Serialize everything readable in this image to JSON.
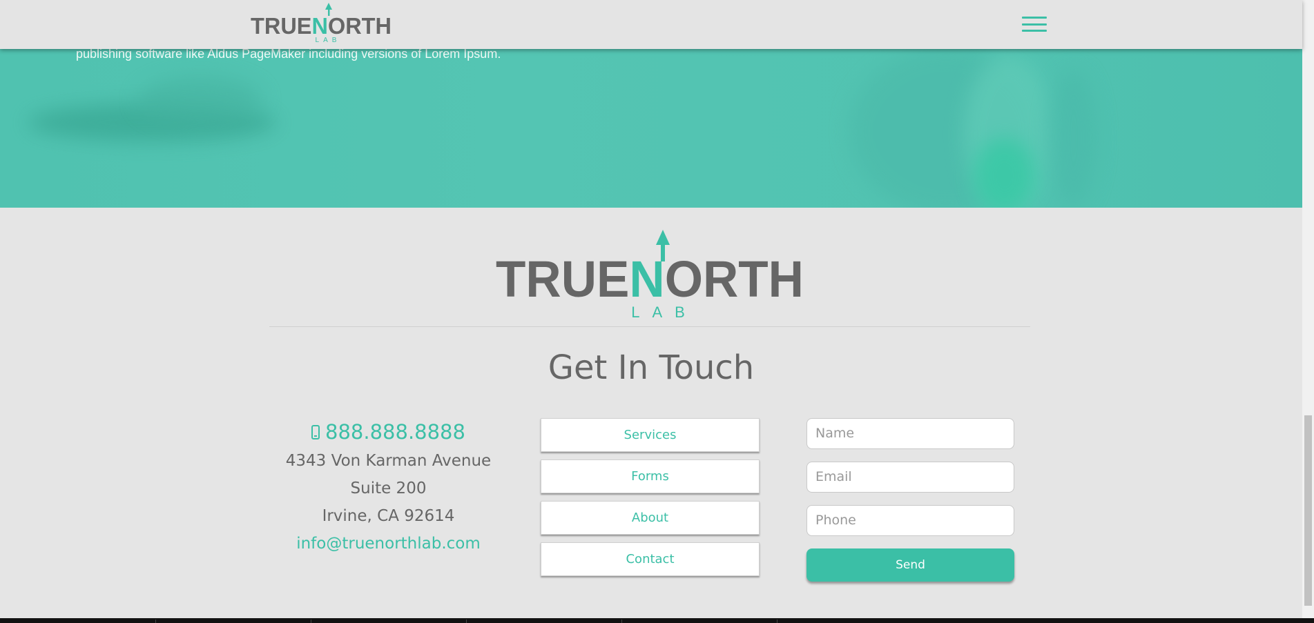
{
  "brand": {
    "name_part1": "TRUE",
    "name_part2": "N",
    "name_part3": "ORTH",
    "sub": "LAB",
    "gray": "#666666",
    "accent": "#3bbfa6"
  },
  "header": {
    "menu_icon": "hamburger-icon"
  },
  "hero": {
    "text": "publishing software like Aldus PageMaker including versions of Lorem Ipsum."
  },
  "footer": {
    "title": "Get In Touch",
    "contact": {
      "phone_icon": "mobile-phone-icon",
      "phone": "888.888.8888",
      "address_line1": "4343 Von Karman Avenue",
      "address_line2": "Suite 200",
      "address_line3": "Irvine, CA 92614",
      "email": "info@truenorthlab.com"
    },
    "nav": [
      {
        "label": "Services"
      },
      {
        "label": "Forms"
      },
      {
        "label": "About"
      },
      {
        "label": "Contact"
      }
    ],
    "form": {
      "name_placeholder": "Name",
      "email_placeholder": "Email",
      "phone_placeholder": "Phone",
      "send_label": "Send"
    }
  }
}
